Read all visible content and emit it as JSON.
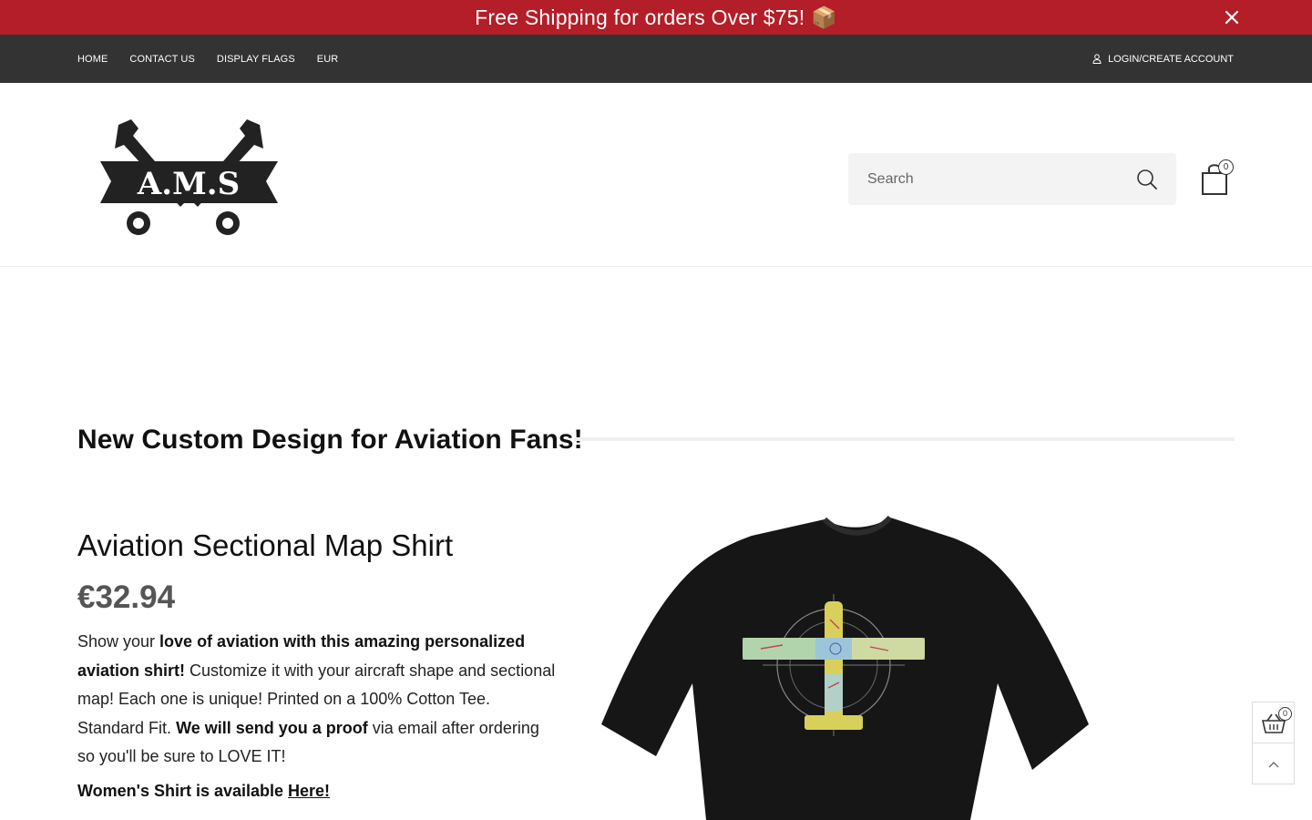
{
  "announcement": {
    "text": "Free Shipping for orders Over $75! 📦",
    "close_icon": "close-icon",
    "background": "#b31e28"
  },
  "top_nav": {
    "items": [
      "HOME",
      "CONTACT US",
      "DISPLAY FLAGS",
      "EUR"
    ],
    "account_label": "LOGIN/CREATE ACCOUNT",
    "account_icon": "user-icon",
    "background": "#333333"
  },
  "header": {
    "logo_text": "A.M.S",
    "logo_icon": "crossed-wrenches-logo",
    "search": {
      "placeholder": "Search",
      "value": "",
      "icon": "search-icon"
    },
    "cart": {
      "icon": "shopping-bag-icon",
      "count": "0"
    }
  },
  "main": {
    "section_title": "New Custom Design for Aviation Fans!",
    "product": {
      "title": "Aviation Sectional Map Shirt",
      "price": "€32.94",
      "desc_1": "Show your ",
      "desc_2": "love of aviation with this amazing personalized aviation shirt!",
      "desc_3": " Customize it with your aircraft shape and sectional map! Each one is unique! Printed on a 100% Cotton Tee. Standard Fit. ",
      "desc_4": "We will send you a proof",
      "desc_5": " via email after ordering so you'll be sure to LOVE IT!",
      "womens_label": "Women's Shirt is available ",
      "womens_link": "Here!",
      "image": "black-tshirt-airplane-map-print"
    }
  },
  "floating": {
    "cart_icon": "basket-icon",
    "cart_count": "0",
    "top_icon": "chevron-up-icon"
  }
}
